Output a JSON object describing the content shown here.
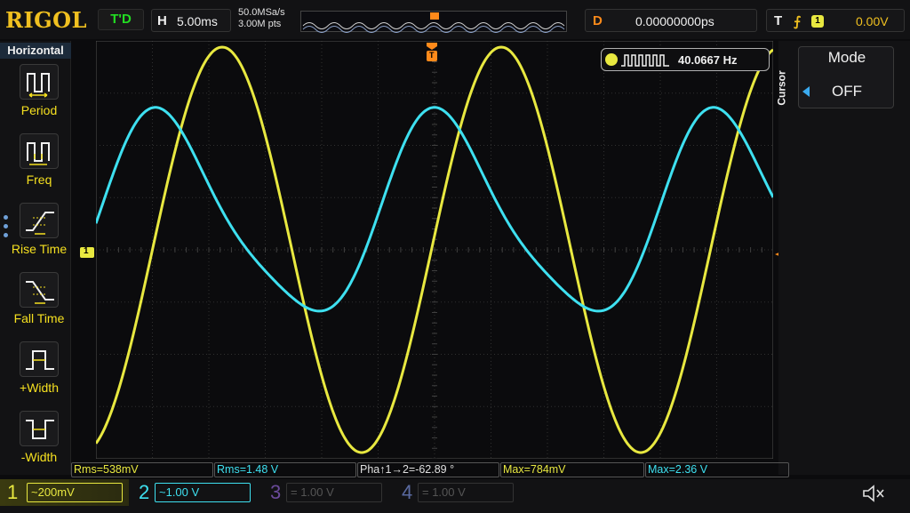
{
  "brand": "RIGOL",
  "topbar": {
    "run_state": "T'D",
    "timebase_label": "H",
    "timebase_value": "5.00ms",
    "sample_rate": "50.0MSa/s",
    "memory_depth": "3.00M pts",
    "delay_label": "D",
    "delay_value": "0.00000000ps",
    "trigger_label": "T",
    "trigger_source": "1",
    "trigger_level": "0.00V"
  },
  "left_menu": {
    "title": "Horizontal",
    "items": [
      {
        "label": "Period",
        "icon": "period-icon"
      },
      {
        "label": "Freq",
        "icon": "frequency-icon"
      },
      {
        "label": "Rise Time",
        "icon": "rise-time-icon"
      },
      {
        "label": "Fall Time",
        "icon": "fall-time-icon"
      },
      {
        "label": "+Width",
        "icon": "positive-width-icon"
      },
      {
        "label": "-Width",
        "icon": "negative-width-icon"
      }
    ]
  },
  "right_menu": {
    "side_label": "Cursor",
    "mode_label": "Mode",
    "mode_value": "OFF"
  },
  "frequency_counter": {
    "channel": "1",
    "value": "40.0667 Hz"
  },
  "measurements": [
    {
      "text": "Rms=538mV"
    },
    {
      "text": "Rms=1.48 V"
    },
    {
      "text": "Pha↑1→2=-62.89 °"
    },
    {
      "text": "Max=784mV"
    },
    {
      "text": "Max=2.36 V"
    }
  ],
  "channels": [
    {
      "num": "1",
      "scale": "~200mV",
      "color": "#e8e840"
    },
    {
      "num": "2",
      "scale": "~1.00 V",
      "color": "#3ee0f0"
    },
    {
      "num": "3",
      "scale": "=    1.00 V",
      "color": "#6a4a9a"
    },
    {
      "num": "4",
      "scale": "=    1.00 V",
      "color": "#5a6aa0"
    }
  ],
  "trigger_marker": "T",
  "ch1_marker": "1"
}
